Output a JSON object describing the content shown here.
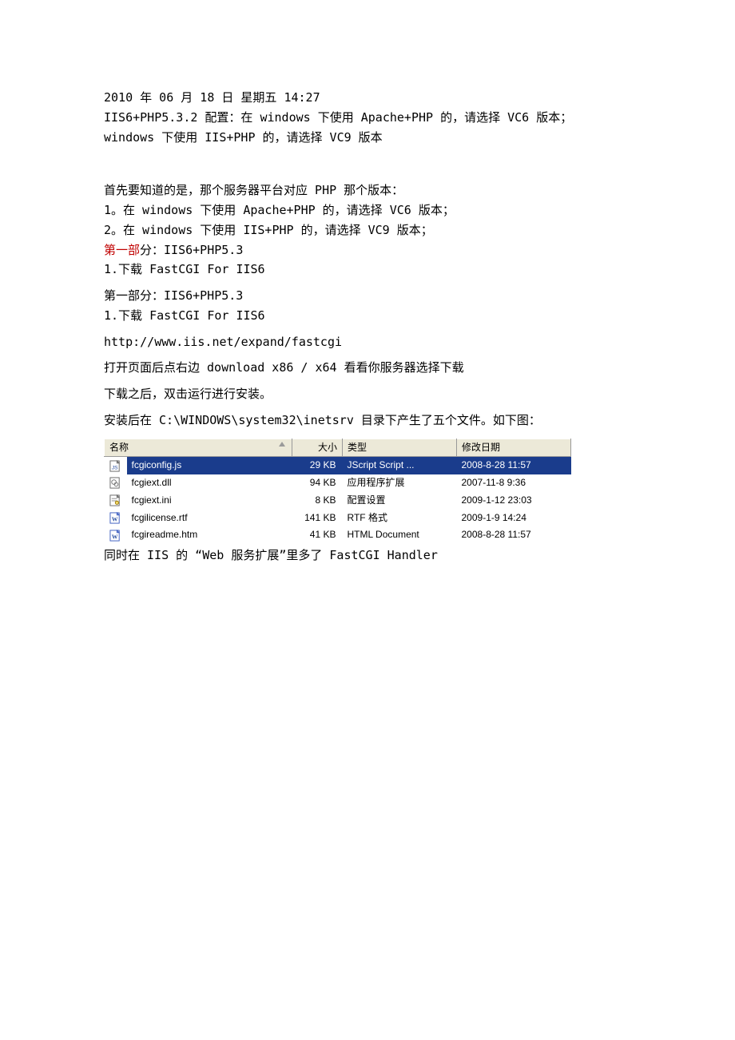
{
  "doc": {
    "dateline": "2010 年 06 月 18 日 星期五 14:27",
    "line2": "IIS6+PHP5.3.2 配置：在 windows 下使用 Apache+PHP 的，请选择 VC6 版本；",
    "line3": "windows 下使用 IIS+PHP 的，请选择 VC9 版本",
    "line4": "首先要知道的是，那个服务器平台对应 PHP 那个版本：",
    "line5": "1。在 windows 下使用 Apache+PHP 的，请选择 VC6 版本；",
    "line6": "2。在 windows 下使用 IIS+PHP 的，请选择 VC9 版本；",
    "line7a": "第一部",
    "line7b": "分：IIS6+PHP5.3",
    "line8": "1.下载 FastCGI For IIS6",
    "line9": "第一部分：IIS6+PHP5.3",
    "line10": "1.下载 FastCGI For IIS6",
    "url": "http://www.iis.net/expand/fastcgi",
    "line11": "打开页面后点右边 download x86 / x64 看看你服务器选择下载",
    "line12": "下载之后，双击运行进行安装。",
    "line13": "安装后在 C:\\WINDOWS\\system32\\inetsrv 目录下产生了五个文件。如下图：",
    "line14": "同时在 IIS 的 “Web 服务扩展”里多了 FastCGI Handler"
  },
  "table": {
    "headers": {
      "name": "名称",
      "size": "大小",
      "type": "类型",
      "date": "修改日期"
    },
    "rows": [
      {
        "icon": "js",
        "name": "fcgiconfig.js",
        "size": "29 KB",
        "type": "JScript Script ...",
        "date": "2008-8-28 11:57",
        "selected": true
      },
      {
        "icon": "dll",
        "name": "fcgiext.dll",
        "size": "94 KB",
        "type": "应用程序扩展",
        "date": "2007-11-8 9:36",
        "selected": false
      },
      {
        "icon": "ini",
        "name": "fcgiext.ini",
        "size": "8 KB",
        "type": "配置设置",
        "date": "2009-1-12 23:03",
        "selected": false
      },
      {
        "icon": "rtf",
        "name": "fcgilicense.rtf",
        "size": "141 KB",
        "type": "RTF 格式",
        "date": "2009-1-9 14:24",
        "selected": false
      },
      {
        "icon": "htm",
        "name": "fcgireadme.htm",
        "size": "41 KB",
        "type": "HTML Document",
        "date": "2008-8-28 11:57",
        "selected": false
      }
    ]
  }
}
